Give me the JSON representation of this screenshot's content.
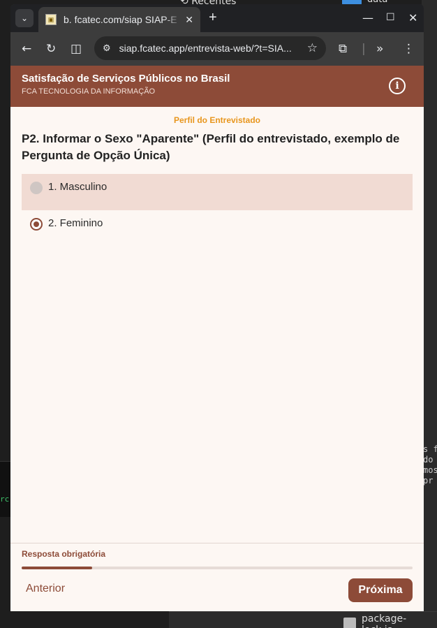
{
  "desktop": {
    "recent_label": "Recentes",
    "folder_label": "data",
    "code_lines": [
      "s f",
      " do",
      "mos",
      " pr"
    ],
    "left_text": "rc",
    "file_label": "package-lock.js"
  },
  "browser": {
    "tab_title": "b. fcatec.com/siap SIAP-E",
    "url": "siap.fcatec.app/entrevista-web/?t=SIA...",
    "icons": [
      "tab-list-icon",
      "close-icon",
      "new-tab-icon",
      "minimize-icon",
      "maximize-icon",
      "close-window-icon",
      "back-icon",
      "reload-icon",
      "split-view-icon",
      "site-settings-icon",
      "star-icon",
      "extensions-icon",
      "more-tools-icon",
      "menu-icon"
    ]
  },
  "app": {
    "title": "Satisfação de Serviços Públicos no Brasil",
    "subtitle": "FCA TECNOLOGIA DA INFORMAÇÃO",
    "section": "Perfil do Entrevistado",
    "question": "P2. Informar o Sexo \"Aparente\" (Perfil do entrevistado, exemplo de Pergunta de Opção Única)",
    "options": [
      {
        "label": "1. Masculino",
        "selected": false
      },
      {
        "label": "2. Feminino",
        "selected": true
      }
    ],
    "required_text": "Resposta obrigatória",
    "progress": 0.18,
    "prev_label": "Anterior",
    "next_label": "Próxima",
    "colors": {
      "primary": "#8d4b38",
      "section": "#e8961d",
      "highlight": "#f1dbd3"
    }
  }
}
